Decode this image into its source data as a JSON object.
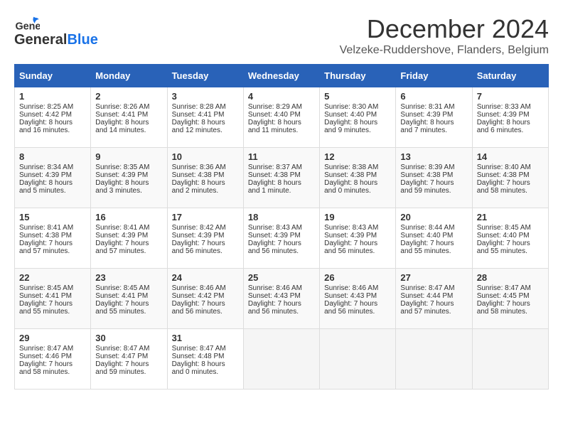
{
  "header": {
    "logo_general": "General",
    "logo_blue": "Blue",
    "month_title": "December 2024",
    "location": "Velzeke-Ruddershove, Flanders, Belgium"
  },
  "days_of_week": [
    "Sunday",
    "Monday",
    "Tuesday",
    "Wednesday",
    "Thursday",
    "Friday",
    "Saturday"
  ],
  "weeks": [
    [
      {
        "day": "1",
        "sunrise": "Sunrise: 8:25 AM",
        "sunset": "Sunset: 4:42 PM",
        "daylight": "Daylight: 8 hours and 16 minutes."
      },
      {
        "day": "2",
        "sunrise": "Sunrise: 8:26 AM",
        "sunset": "Sunset: 4:41 PM",
        "daylight": "Daylight: 8 hours and 14 minutes."
      },
      {
        "day": "3",
        "sunrise": "Sunrise: 8:28 AM",
        "sunset": "Sunset: 4:41 PM",
        "daylight": "Daylight: 8 hours and 12 minutes."
      },
      {
        "day": "4",
        "sunrise": "Sunrise: 8:29 AM",
        "sunset": "Sunset: 4:40 PM",
        "daylight": "Daylight: 8 hours and 11 minutes."
      },
      {
        "day": "5",
        "sunrise": "Sunrise: 8:30 AM",
        "sunset": "Sunset: 4:40 PM",
        "daylight": "Daylight: 8 hours and 9 minutes."
      },
      {
        "day": "6",
        "sunrise": "Sunrise: 8:31 AM",
        "sunset": "Sunset: 4:39 PM",
        "daylight": "Daylight: 8 hours and 7 minutes."
      },
      {
        "day": "7",
        "sunrise": "Sunrise: 8:33 AM",
        "sunset": "Sunset: 4:39 PM",
        "daylight": "Daylight: 8 hours and 6 minutes."
      }
    ],
    [
      {
        "day": "8",
        "sunrise": "Sunrise: 8:34 AM",
        "sunset": "Sunset: 4:39 PM",
        "daylight": "Daylight: 8 hours and 5 minutes."
      },
      {
        "day": "9",
        "sunrise": "Sunrise: 8:35 AM",
        "sunset": "Sunset: 4:39 PM",
        "daylight": "Daylight: 8 hours and 3 minutes."
      },
      {
        "day": "10",
        "sunrise": "Sunrise: 8:36 AM",
        "sunset": "Sunset: 4:38 PM",
        "daylight": "Daylight: 8 hours and 2 minutes."
      },
      {
        "day": "11",
        "sunrise": "Sunrise: 8:37 AM",
        "sunset": "Sunset: 4:38 PM",
        "daylight": "Daylight: 8 hours and 1 minute."
      },
      {
        "day": "12",
        "sunrise": "Sunrise: 8:38 AM",
        "sunset": "Sunset: 4:38 PM",
        "daylight": "Daylight: 8 hours and 0 minutes."
      },
      {
        "day": "13",
        "sunrise": "Sunrise: 8:39 AM",
        "sunset": "Sunset: 4:38 PM",
        "daylight": "Daylight: 7 hours and 59 minutes."
      },
      {
        "day": "14",
        "sunrise": "Sunrise: 8:40 AM",
        "sunset": "Sunset: 4:38 PM",
        "daylight": "Daylight: 7 hours and 58 minutes."
      }
    ],
    [
      {
        "day": "15",
        "sunrise": "Sunrise: 8:41 AM",
        "sunset": "Sunset: 4:38 PM",
        "daylight": "Daylight: 7 hours and 57 minutes."
      },
      {
        "day": "16",
        "sunrise": "Sunrise: 8:41 AM",
        "sunset": "Sunset: 4:39 PM",
        "daylight": "Daylight: 7 hours and 57 minutes."
      },
      {
        "day": "17",
        "sunrise": "Sunrise: 8:42 AM",
        "sunset": "Sunset: 4:39 PM",
        "daylight": "Daylight: 7 hours and 56 minutes."
      },
      {
        "day": "18",
        "sunrise": "Sunrise: 8:43 AM",
        "sunset": "Sunset: 4:39 PM",
        "daylight": "Daylight: 7 hours and 56 minutes."
      },
      {
        "day": "19",
        "sunrise": "Sunrise: 8:43 AM",
        "sunset": "Sunset: 4:39 PM",
        "daylight": "Daylight: 7 hours and 56 minutes."
      },
      {
        "day": "20",
        "sunrise": "Sunrise: 8:44 AM",
        "sunset": "Sunset: 4:40 PM",
        "daylight": "Daylight: 7 hours and 55 minutes."
      },
      {
        "day": "21",
        "sunrise": "Sunrise: 8:45 AM",
        "sunset": "Sunset: 4:40 PM",
        "daylight": "Daylight: 7 hours and 55 minutes."
      }
    ],
    [
      {
        "day": "22",
        "sunrise": "Sunrise: 8:45 AM",
        "sunset": "Sunset: 4:41 PM",
        "daylight": "Daylight: 7 hours and 55 minutes."
      },
      {
        "day": "23",
        "sunrise": "Sunrise: 8:45 AM",
        "sunset": "Sunset: 4:41 PM",
        "daylight": "Daylight: 7 hours and 55 minutes."
      },
      {
        "day": "24",
        "sunrise": "Sunrise: 8:46 AM",
        "sunset": "Sunset: 4:42 PM",
        "daylight": "Daylight: 7 hours and 56 minutes."
      },
      {
        "day": "25",
        "sunrise": "Sunrise: 8:46 AM",
        "sunset": "Sunset: 4:43 PM",
        "daylight": "Daylight: 7 hours and 56 minutes."
      },
      {
        "day": "26",
        "sunrise": "Sunrise: 8:46 AM",
        "sunset": "Sunset: 4:43 PM",
        "daylight": "Daylight: 7 hours and 56 minutes."
      },
      {
        "day": "27",
        "sunrise": "Sunrise: 8:47 AM",
        "sunset": "Sunset: 4:44 PM",
        "daylight": "Daylight: 7 hours and 57 minutes."
      },
      {
        "day": "28",
        "sunrise": "Sunrise: 8:47 AM",
        "sunset": "Sunset: 4:45 PM",
        "daylight": "Daylight: 7 hours and 58 minutes."
      }
    ],
    [
      {
        "day": "29",
        "sunrise": "Sunrise: 8:47 AM",
        "sunset": "Sunset: 4:46 PM",
        "daylight": "Daylight: 7 hours and 58 minutes."
      },
      {
        "day": "30",
        "sunrise": "Sunrise: 8:47 AM",
        "sunset": "Sunset: 4:47 PM",
        "daylight": "Daylight: 7 hours and 59 minutes."
      },
      {
        "day": "31",
        "sunrise": "Sunrise: 8:47 AM",
        "sunset": "Sunset: 4:48 PM",
        "daylight": "Daylight: 8 hours and 0 minutes."
      },
      {
        "day": "",
        "sunrise": "",
        "sunset": "",
        "daylight": ""
      },
      {
        "day": "",
        "sunrise": "",
        "sunset": "",
        "daylight": ""
      },
      {
        "day": "",
        "sunrise": "",
        "sunset": "",
        "daylight": ""
      },
      {
        "day": "",
        "sunrise": "",
        "sunset": "",
        "daylight": ""
      }
    ]
  ]
}
